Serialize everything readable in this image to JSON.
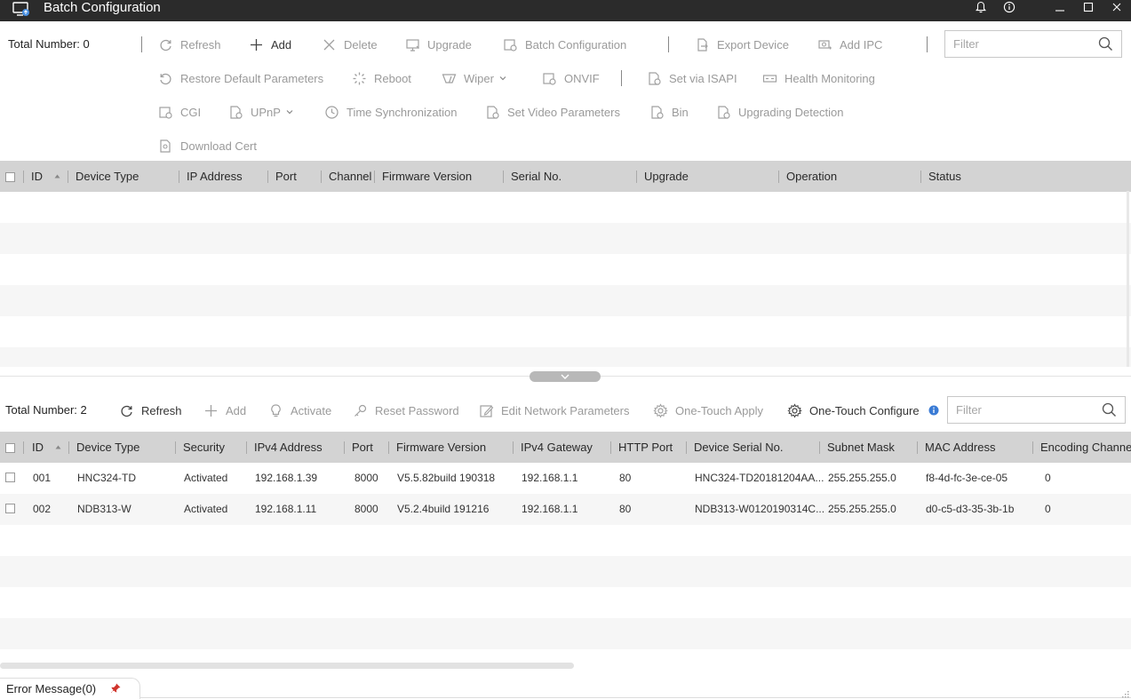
{
  "window": {
    "title": "Batch Configuration"
  },
  "top": {
    "total_label": "Total Number: 0",
    "filter_placeholder": "Filter",
    "toolbar": {
      "refresh": "Refresh",
      "add": "Add",
      "delete": "Delete",
      "upgrade": "Upgrade",
      "batch_configuration": "Batch Configuration",
      "export_device": "Export Device",
      "add_ipc": "Add IPC",
      "restore_default": "Restore Default Parameters",
      "reboot": "Reboot",
      "wiper": "Wiper",
      "onvif": "ONVIF",
      "set_via_isapi": "Set via ISAPI",
      "health_monitoring": "Health Monitoring",
      "cgi": "CGI",
      "upnp": "UPnP",
      "time_sync": "Time Synchronization",
      "set_video_params": "Set Video Parameters",
      "bin": "Bin",
      "upgrading_detection": "Upgrading Detection",
      "download_cert": "Download Cert"
    },
    "columns": [
      "ID",
      "Device Type",
      "IP Address",
      "Port",
      "Channel",
      "Firmware Version",
      "Serial No.",
      "Upgrade",
      "Operation",
      "Status"
    ]
  },
  "bottom": {
    "total_label": "Total Number: 2",
    "filter_placeholder": "Filter",
    "toolbar": {
      "refresh": "Refresh",
      "add": "Add",
      "activate": "Activate",
      "reset_password": "Reset Password",
      "edit_network": "Edit Network Parameters",
      "one_touch_apply": "One-Touch Apply",
      "one_touch_configure": "One-Touch Configure"
    },
    "columns": [
      "ID",
      "Device Type",
      "Security",
      "IPv4 Address",
      "Port",
      "Firmware Version",
      "IPv4 Gateway",
      "HTTP Port",
      "Device Serial No.",
      "Subnet Mask",
      "MAC Address",
      "Encoding Channel"
    ],
    "rows": [
      [
        "001",
        "HNC324-TD",
        "Activated",
        "192.168.1.39",
        "8000",
        "V5.5.82build 190318",
        "192.168.1.1",
        "80",
        "HNC324-TD20181204AA...",
        "255.255.255.0",
        "f8-4d-fc-3e-ce-05",
        "0"
      ],
      [
        "002",
        "NDB313-W",
        "Activated",
        "192.168.1.11",
        "8000",
        "V5.2.4build 191216",
        "192.168.1.1",
        "80",
        "NDB313-W0120190314C...",
        "255.255.255.0",
        "d0-c5-d3-35-3b-1b",
        "0"
      ]
    ]
  },
  "status": {
    "error_message": "Error Message(0)"
  },
  "colors": {
    "titlebar": "#2b2b2b",
    "header_bg": "#d3d3d3",
    "disabled_text": "#9a9a9a",
    "info_blue": "#3a7bd5",
    "pin_red": "#d0342c"
  }
}
